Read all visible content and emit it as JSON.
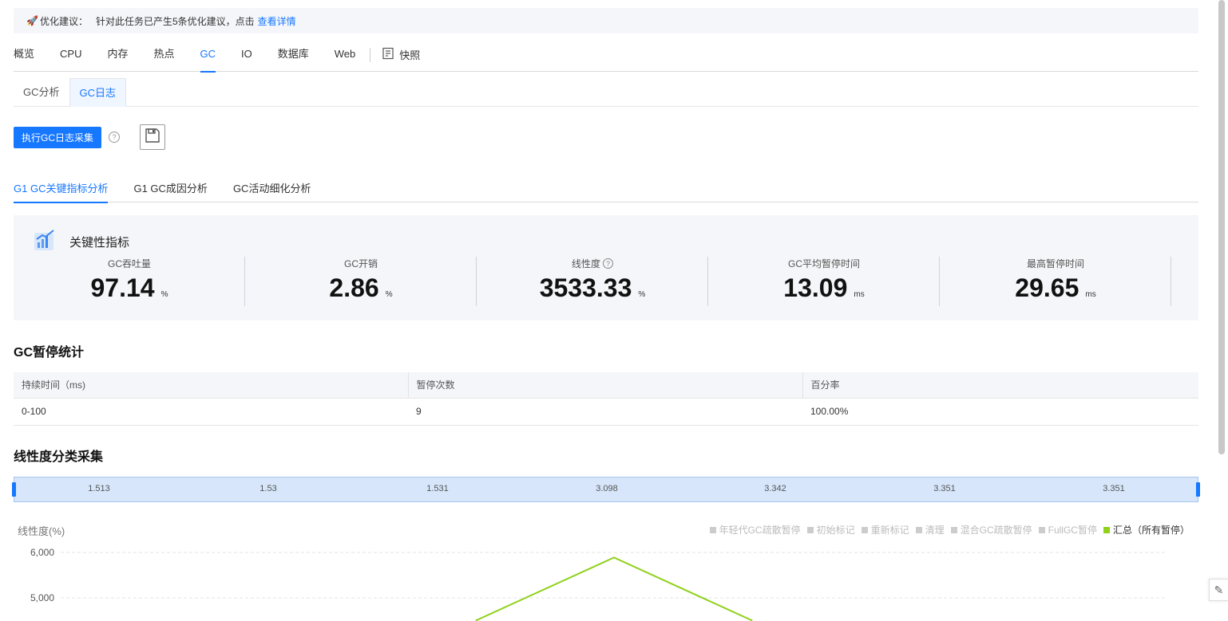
{
  "banner": {
    "title": "优化建议：",
    "text": "针对此任务已产生5条优化建议，点击",
    "link": "查看详情"
  },
  "main_tabs": [
    {
      "label": "概览"
    },
    {
      "label": "CPU"
    },
    {
      "label": "内存"
    },
    {
      "label": "热点"
    },
    {
      "label": "GC",
      "active": true
    },
    {
      "label": "IO"
    },
    {
      "label": "数据库"
    },
    {
      "label": "Web"
    }
  ],
  "snapshot_label": "快照",
  "card_tabs": [
    {
      "label": "GC分析"
    },
    {
      "label": "GC日志",
      "active": true
    }
  ],
  "actions": {
    "run_label": "执行GC日志采集",
    "help": "?"
  },
  "sub_tabs": [
    {
      "label": "G1 GC关键指标分析",
      "active": true
    },
    {
      "label": "G1 GC成因分析"
    },
    {
      "label": "GC活动细化分析"
    }
  ],
  "metrics": {
    "title": "关键性指标",
    "items": [
      {
        "label": "GC吞吐量",
        "value": "97.14",
        "unit": "%"
      },
      {
        "label": "GC开销",
        "value": "2.86",
        "unit": "%"
      },
      {
        "label": "线性度",
        "value": "3533.33",
        "unit": "%",
        "help": "?"
      },
      {
        "label": "GC平均暂停时间",
        "value": "13.09",
        "unit": "ms"
      },
      {
        "label": "最高暂停时间",
        "value": "29.65",
        "unit": "ms"
      }
    ]
  },
  "pause_stats": {
    "title": "GC暂停统计",
    "columns": [
      "持续时间（ms)",
      "暂停次数",
      "百分率"
    ],
    "rows": [
      [
        "0-100",
        "9",
        "100.00%"
      ]
    ]
  },
  "linearity": {
    "title": "线性度分类采集",
    "range_ticks": [
      "1.513",
      "1.53",
      "1.531",
      "3.098",
      "3.342",
      "3.351",
      "3.351"
    ]
  },
  "chart_data": {
    "type": "line",
    "ylabel": "线性度(%)",
    "y_ticks": [
      "6,000",
      "5,000"
    ],
    "ylim": [
      4500,
      6200
    ],
    "legend": [
      {
        "name": "年轻代GC疏散暂停",
        "active": false
      },
      {
        "name": "初始标记",
        "active": false
      },
      {
        "name": "重新标记",
        "active": false
      },
      {
        "name": "清理",
        "active": false
      },
      {
        "name": "混合GC疏散暂停",
        "active": false
      },
      {
        "name": "FullGC暂停",
        "active": false
      },
      {
        "name": "汇总（所有暂停）",
        "active": true
      }
    ],
    "series": [
      {
        "name": "汇总（所有暂停）",
        "color": "#8fd11b",
        "x": [
          3,
          4,
          5
        ],
        "y": [
          4500,
          5888,
          4500
        ]
      }
    ],
    "x_domain": [
      0,
      8
    ]
  },
  "colors": {
    "accent": "#1677ff",
    "series": "#8fd11b"
  }
}
